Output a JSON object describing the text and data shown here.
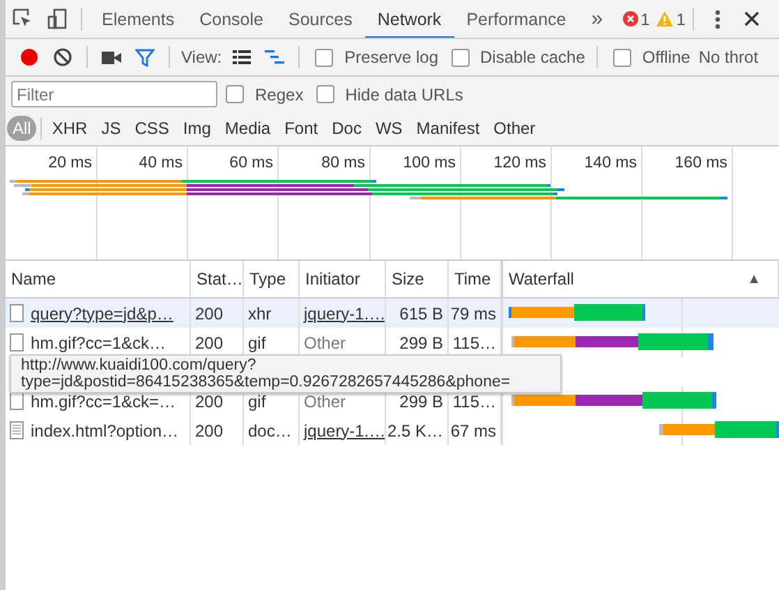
{
  "toolbar": {
    "tabs": [
      {
        "label": "Elements",
        "selected": false
      },
      {
        "label": "Console",
        "selected": false
      },
      {
        "label": "Sources",
        "selected": false
      },
      {
        "label": "Network",
        "selected": true
      },
      {
        "label": "Performance",
        "selected": false
      }
    ],
    "more": "»",
    "errors": "1",
    "warnings": "1"
  },
  "controls": {
    "recording": true,
    "filter_shown": true,
    "view_label": "View:",
    "overview_view": true,
    "checkboxes": [
      {
        "label": "Preserve log",
        "checked": false
      },
      {
        "label": "Disable cache",
        "checked": false
      },
      {
        "label": "Offline",
        "checked": false
      }
    ],
    "throttling": "No throt"
  },
  "filter": {
    "placeholder": "Filter",
    "checkboxes": [
      {
        "label": "Regex",
        "checked": false
      },
      {
        "label": "Hide data URLs",
        "checked": false
      }
    ]
  },
  "types": [
    {
      "label": "All",
      "selected": true
    },
    {
      "label": "XHR",
      "selected": false
    },
    {
      "label": "JS",
      "selected": false
    },
    {
      "label": "CSS",
      "selected": false
    },
    {
      "label": "Img",
      "selected": false
    },
    {
      "label": "Media",
      "selected": false
    },
    {
      "label": "Font",
      "selected": false
    },
    {
      "label": "Doc",
      "selected": false
    },
    {
      "label": "WS",
      "selected": false
    },
    {
      "label": "Manifest",
      "selected": false
    },
    {
      "label": "Other",
      "selected": false
    }
  ],
  "overview": {
    "ticks": [
      "20 ms",
      "40 ms",
      "60 ms",
      "80 ms",
      "100 ms",
      "120 ms",
      "140 ms",
      "160 ms"
    ]
  },
  "table": {
    "columns": [
      "Name",
      "Stat…",
      "Type",
      "Initiator",
      "Size",
      "Time",
      "Waterfall"
    ],
    "sort": "▲",
    "rows": [
      {
        "kind": "file",
        "name": "query?type=jd&p…",
        "name_link": true,
        "status": "200",
        "type": "xhr",
        "initiator": "jquery-1.…",
        "initiator_link": true,
        "size": "615 B",
        "time": "79 ms",
        "selected": true
      },
      {
        "kind": "file",
        "name": "hm.gif?cc=1&ck…",
        "name_link": false,
        "status": "200",
        "type": "gif",
        "initiator": "Other",
        "initiator_link": false,
        "size": "299 B",
        "time": "115…",
        "selected": false
      },
      {
        "kind": "file",
        "name": "hm.gif?cc=1&ck=…",
        "name_link": false,
        "status": "200",
        "type": "gif",
        "initiator": "Other",
        "initiator_link": false,
        "size": "299 B",
        "time": "115…",
        "selected": false
      },
      {
        "kind": "document",
        "name": "index.html?option…",
        "name_link": false,
        "status": "200",
        "type": "doc…",
        "initiator": "jquery-1.…",
        "initiator_link": true,
        "size": "2.5 K…",
        "time": "67 ms",
        "selected": false
      }
    ]
  },
  "tooltip": {
    "lines": [
      "http://www.kuaidi100.com/query?",
      "type=jd&postid=86415238365&temp=0.9267282657445286&phone="
    ]
  }
}
